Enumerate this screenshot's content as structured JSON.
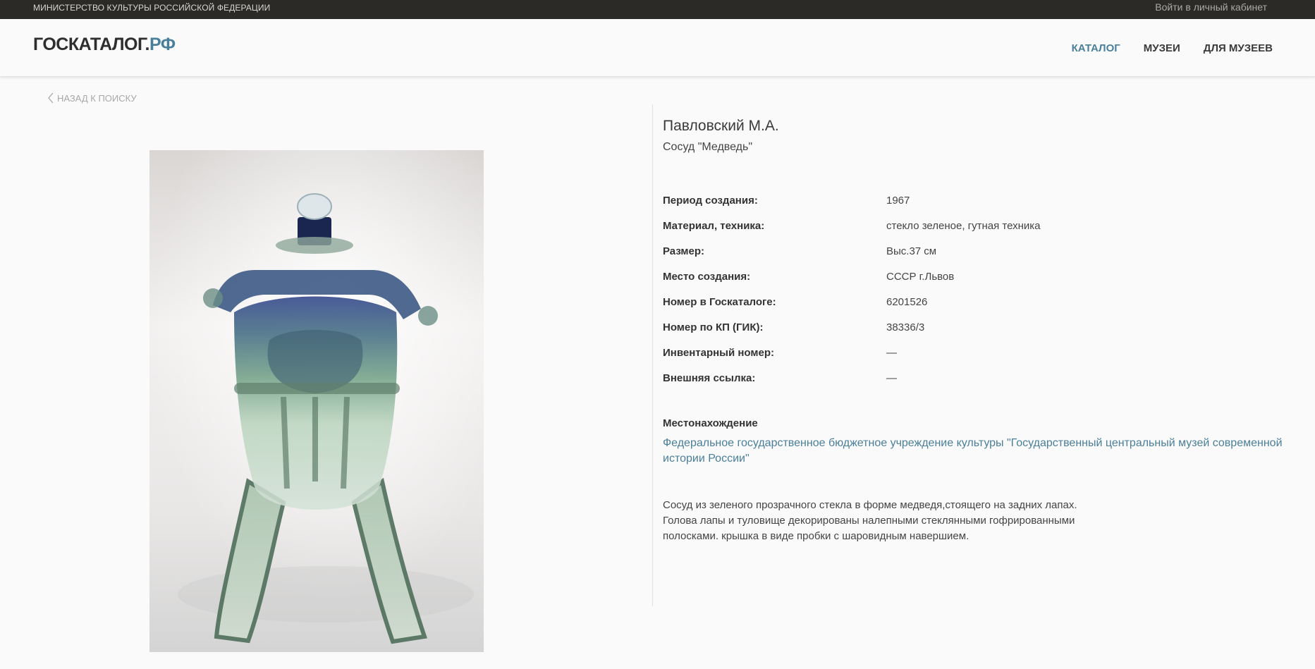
{
  "topbar": {
    "ministry": "Министерство культуры Российской Федерации",
    "login": "Войти в личный кабинет"
  },
  "header": {
    "logo_main": "ГОСКАТАЛОГ.",
    "logo_accent": "РФ",
    "nav": [
      {
        "label": "КАТАЛОГ",
        "active": true
      },
      {
        "label": "МУЗЕИ",
        "active": false
      },
      {
        "label": "ДЛЯ МУЗЕЕВ",
        "active": false
      }
    ]
  },
  "back_link": "Назад к поиску",
  "object": {
    "author": "Павловский М.А.",
    "title": "Сосуд \"Медведь\"",
    "properties": [
      {
        "key": "Период создания:",
        "value": "1967"
      },
      {
        "key": "Материал, техника:",
        "value": "стекло зеленое, гутная техника"
      },
      {
        "key": "Размер:",
        "value": "Выс.37 см"
      },
      {
        "key": "Место создания:",
        "value": "СССР г.Львов"
      },
      {
        "key": "Номер в Госкаталоге:",
        "value": "6201526"
      },
      {
        "key": "Номер по КП (ГИК):",
        "value": "38336/3"
      },
      {
        "key": "Инвентарный номер:",
        "value": "—"
      },
      {
        "key": "Внешняя ссылка:",
        "value": "—"
      }
    ],
    "location_heading": "Местонахождение",
    "location_link": "Федеральное государственное бюджетное учреждение культуры \"Государственный центральный музей современной истории России\"",
    "description": "Сосуд из зеленого прозрачного стекла в форме медведя,стоящего на задних лапах. Голова лапы и туловище декорированы налепными стеклянными гофрированными полосками. крышка в виде пробки с шаровидным навершием."
  },
  "colors": {
    "topbar_bg": "#2b2a26",
    "accent": "#4a7f9b",
    "page_bg": "#fafafa"
  }
}
